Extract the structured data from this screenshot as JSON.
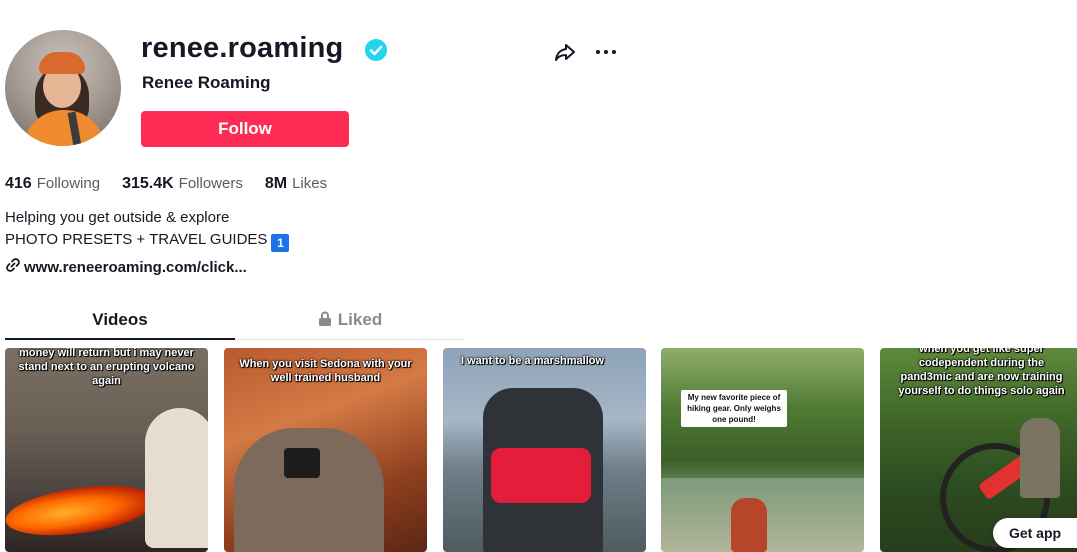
{
  "profile": {
    "username": "renee.roaming",
    "display_name": "Renee Roaming",
    "verified": true,
    "follow_label": "Follow",
    "accent_color": "#fe2c55",
    "verified_color": "#20d5ec"
  },
  "stats": [
    {
      "value": "416",
      "label": "Following"
    },
    {
      "value": "315.4K",
      "label": "Followers"
    },
    {
      "value": "8M",
      "label": "Likes"
    }
  ],
  "bio": {
    "line1": "Helping you get outside & explore",
    "line2": "PHOTO PRESETS + TRAVEL GUIDES",
    "line2_badge": "1"
  },
  "link": "www.reneeroaming.com/click...",
  "tabs": {
    "videos": "Videos",
    "liked": "Liked",
    "active": "videos"
  },
  "videos": [
    {
      "caption": "money will return but i may never stand next to an erupting volcano again"
    },
    {
      "caption": "When you visit Sedona with your well trained husband"
    },
    {
      "caption": "I want to be a marshmallow"
    },
    {
      "caption": "My new favorite piece of hiking gear. Only weighs one pound!"
    },
    {
      "caption": "when you get like super codependent during the pand3mic and are now training yourself to do things solo again"
    }
  ],
  "get_app_label": "Get app",
  "icons": {
    "share": "share-icon",
    "more": "more-icon",
    "link": "link-icon",
    "lock": "lock-icon",
    "verified": "verified-icon"
  }
}
